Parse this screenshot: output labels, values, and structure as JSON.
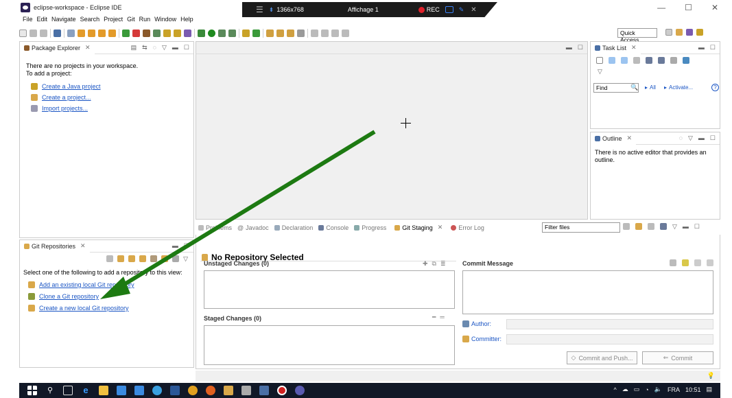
{
  "window": {
    "title": "eclipse-workspace - Eclipse IDE",
    "controls": [
      "—",
      "☐",
      "✕"
    ]
  },
  "recorder": {
    "resolution": "1366x768",
    "display": "Affichage 1",
    "rec_label": "REC"
  },
  "menu": [
    "File",
    "Edit",
    "Navigate",
    "Search",
    "Project",
    "Git",
    "Run",
    "Window",
    "Help"
  ],
  "quick_access": {
    "placeholder": "Quick Access"
  },
  "package_explorer": {
    "tab_label": "Package Explorer",
    "message_line1": "There are no projects in your workspace.",
    "message_line2": "To add a project:",
    "links": [
      "Create a Java project",
      "Create a project...",
      "Import projects..."
    ]
  },
  "task_list": {
    "tab_label": "Task List",
    "find_placeholder": "Find",
    "all_label": "All",
    "activate_label": "Activate...",
    "help": "?"
  },
  "outline": {
    "tab_label": "Outline",
    "message": "There is no active editor that provides an outline."
  },
  "git_repositories": {
    "tab_label": "Git Repositories",
    "instruction": "Select one of the following to add a repository to this view:",
    "links": [
      "Add an existing local Git repository",
      "Clone a Git repository",
      "Create a new local Git repository"
    ]
  },
  "bottom_tabs": [
    "Problems",
    "Javadoc",
    "Declaration",
    "Console",
    "Progress",
    "Git Staging",
    "Error Log"
  ],
  "filter": {
    "placeholder": "Filter files"
  },
  "git_staging": {
    "header": "No Repository Selected",
    "unstaged": "Unstaged Changes (0)",
    "staged": "Staged Changes (0)",
    "commit_message": "Commit Message",
    "author_label": "Author:",
    "committer_label": "Committer:",
    "commit_push_label": "Commit and Push...",
    "commit_label": "Commit"
  },
  "taskbar": {
    "language": "FRA",
    "time": "10:51"
  },
  "colors": {
    "arrow": "#1d7a12",
    "link": "#1a55c4",
    "taskbar": "#111827"
  }
}
